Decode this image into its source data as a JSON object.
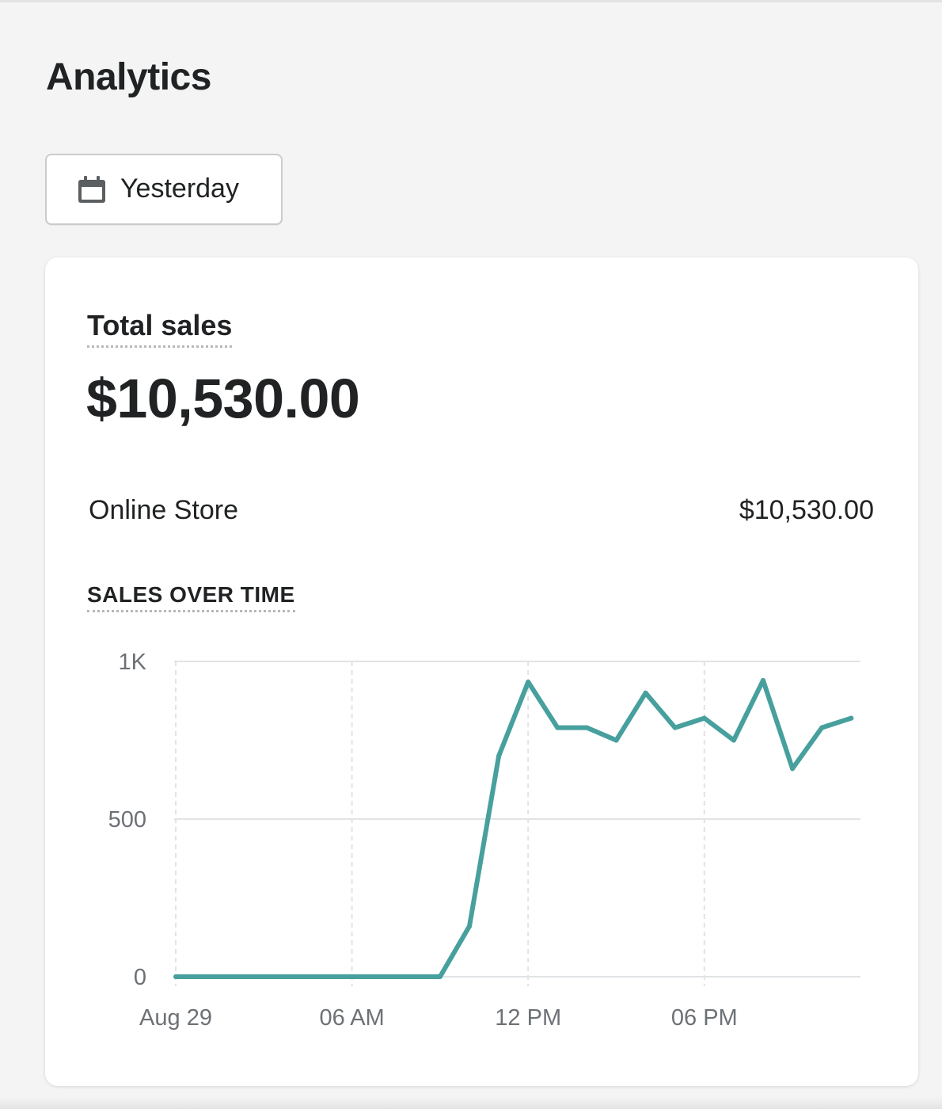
{
  "page": {
    "title": "Analytics"
  },
  "date_picker": {
    "label": "Yesterday",
    "icon": "calendar-icon"
  },
  "card": {
    "title": "Total sales",
    "total": "$10,530.00",
    "channels": [
      {
        "name": "Online Store",
        "value": "$10,530.00"
      }
    ],
    "section_title": "SALES OVER TIME"
  },
  "colors": {
    "line": "#47a09d",
    "grid": "#e1e3e5",
    "text_muted": "#6d7175"
  },
  "chart_data": {
    "type": "line",
    "title": "SALES OVER TIME",
    "x": [
      "00:00",
      "01:00",
      "02:00",
      "03:00",
      "04:00",
      "05:00",
      "06:00",
      "07:00",
      "08:00",
      "09:00",
      "10:00",
      "11:00",
      "12:00",
      "13:00",
      "14:00",
      "15:00",
      "16:00",
      "17:00",
      "18:00",
      "19:00",
      "20:00",
      "21:00",
      "22:00",
      "23:00"
    ],
    "x_tick_labels": [
      {
        "label": "Aug 29",
        "x": "00:00"
      },
      {
        "label": "06 AM",
        "x": "06:00"
      },
      {
        "label": "12 PM",
        "x": "12:00"
      },
      {
        "label": "06 PM",
        "x": "18:00"
      }
    ],
    "y_tick_labels": [
      {
        "label": "0",
        "value": 0
      },
      {
        "label": "500",
        "value": 500
      },
      {
        "label": "1K",
        "value": 1000
      }
    ],
    "series": [
      {
        "values": [
          0,
          0,
          0,
          0,
          0,
          0,
          0,
          0,
          0,
          0,
          160,
          700,
          935,
          790,
          790,
          750,
          900,
          790,
          820,
          750,
          940,
          660,
          790,
          820
        ]
      }
    ],
    "ylim": [
      0,
      1000
    ],
    "grid": true
  }
}
